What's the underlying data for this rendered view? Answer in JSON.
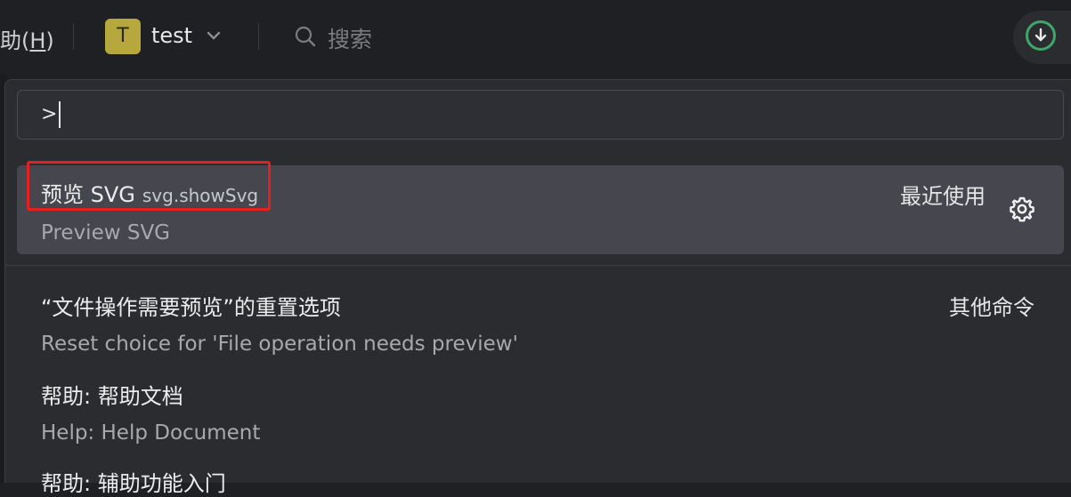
{
  "titlebar": {
    "help_menu_prefix": "助(",
    "help_menu_key": "H",
    "help_menu_suffix": ")",
    "workspace": {
      "avatar_letter": "T",
      "name": "test"
    },
    "search_placeholder": "搜索"
  },
  "palette": {
    "input_value": ">",
    "items": [
      {
        "title": "预览 SVG",
        "command_id": "svg.showSvg",
        "subtitle": "Preview SVG",
        "right_label": "最近使用",
        "selected": true
      },
      {
        "title": "“文件操作需要预览”的重置选项",
        "subtitle": "Reset choice for 'File operation needs preview'",
        "right_label": "其他命令"
      },
      {
        "title": "帮助: 帮助文档",
        "subtitle": "Help: Help Document"
      },
      {
        "title": "帮助: 辅助功能入门"
      }
    ]
  },
  "colors": {
    "accent_download": "#3fa66a",
    "workspace_avatar": "#b7a83e",
    "annotation_red": "#e62020"
  }
}
